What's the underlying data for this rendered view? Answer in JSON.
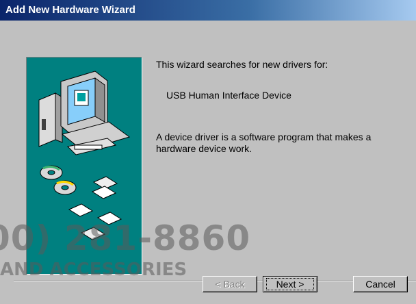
{
  "window": {
    "title": "Add New Hardware Wizard"
  },
  "main": {
    "intro": "This wizard searches for new drivers for:",
    "device_name": "USB Human Interface Device",
    "description": "A device driver is a software program that makes a hardware device work."
  },
  "watermark": {
    "phone": "00) 281-8860",
    "text": "AND ACCESSORIES"
  },
  "buttons": {
    "back": "< Back",
    "next": "Next >",
    "cancel": "Cancel"
  },
  "colors": {
    "panel_teal": "#008080",
    "titlebar": "#0a246a",
    "dialog": "#c0c0c0"
  },
  "icons": [
    "computer-illustration-icon",
    "cd-disc-icon",
    "floppy-disk-icon"
  ]
}
